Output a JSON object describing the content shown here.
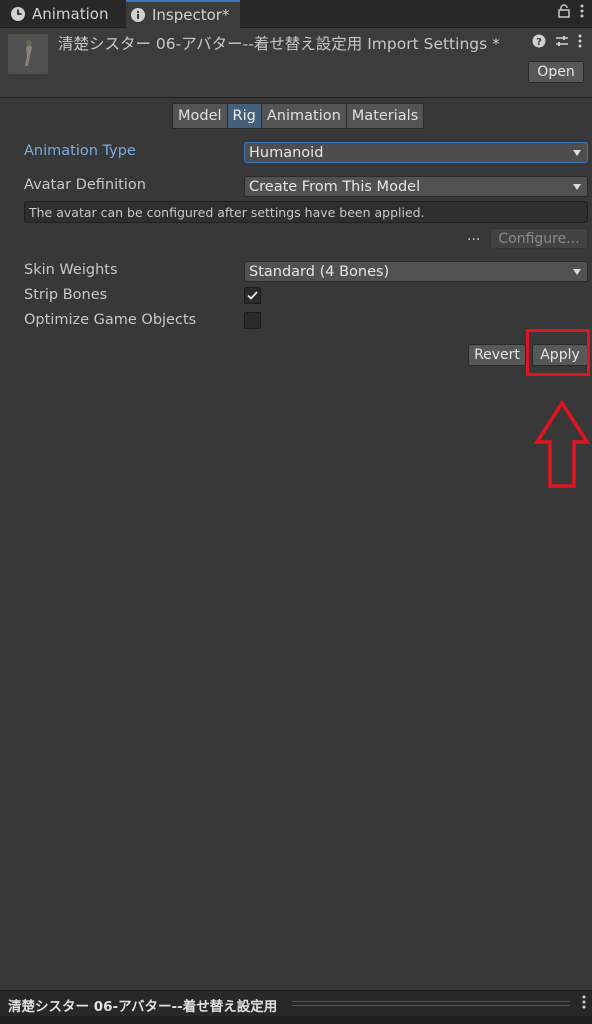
{
  "tabs": [
    {
      "label": "Animation",
      "icon": "clock-icon"
    },
    {
      "label": "Inspector*",
      "icon": "info-icon"
    }
  ],
  "header": {
    "title": "清楚シスター 06-アバター--着せ替え設定用 Import Settings *",
    "open_label": "Open"
  },
  "segments": [
    "Model",
    "Rig",
    "Animation",
    "Materials"
  ],
  "active_segment": "Rig",
  "rig": {
    "animation_type_label": "Animation Type",
    "animation_type_value": "Humanoid",
    "avatar_definition_label": "Avatar Definition",
    "avatar_definition_value": "Create From This Model",
    "info_text": "The avatar can be configured after settings have been applied.",
    "dots": "...",
    "configure_label": "Configure...",
    "skin_weights_label": "Skin Weights",
    "skin_weights_value": "Standard (4 Bones)",
    "strip_bones_label": "Strip Bones",
    "strip_bones_checked": true,
    "optimize_label": "Optimize Game Objects",
    "optimize_checked": false
  },
  "actions": {
    "revert_label": "Revert",
    "apply_label": "Apply"
  },
  "footer": {
    "title": "清楚シスター 06-アバター--着せ替え設定用"
  },
  "colors": {
    "highlight": "#e0141e",
    "accent": "#3a79bb",
    "active_segment": "#46607c"
  }
}
